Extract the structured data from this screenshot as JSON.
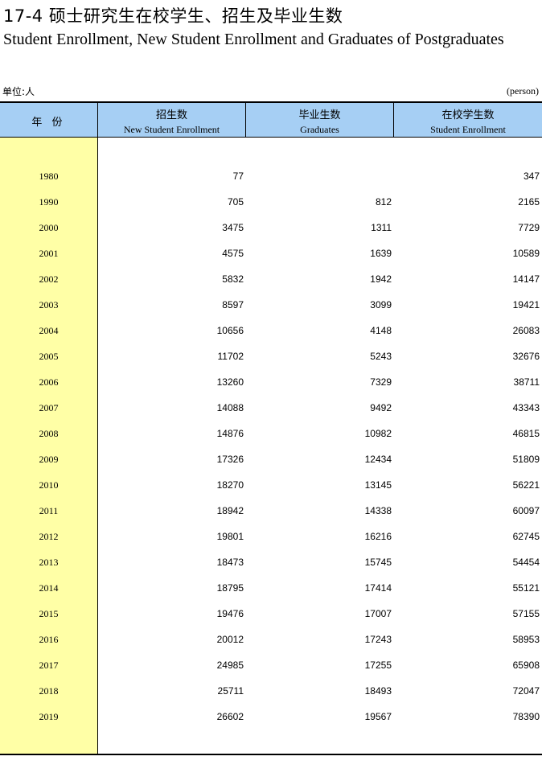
{
  "title_cn": "17-4  硕士研究生在校学生、招生及毕业生数",
  "title_en": "Student Enrollment, New Student Enrollment and Graduates of Postgraduates",
  "unit_cn": "单位:人",
  "unit_en": "(person)",
  "headers": {
    "year": "年 份",
    "new_cn": "招生数",
    "new_en": "New Student Enrollment",
    "grad_cn": "毕业生数",
    "grad_en": "Graduates",
    "enroll_cn": "在校学生数",
    "enroll_en": "Student Enrollment"
  },
  "rows": [
    {
      "year": "1980",
      "new": "77",
      "grad": "",
      "enroll": "347"
    },
    {
      "year": "1990",
      "new": "705",
      "grad": "812",
      "enroll": "2165"
    },
    {
      "year": "2000",
      "new": "3475",
      "grad": "1311",
      "enroll": "7729"
    },
    {
      "year": "2001",
      "new": "4575",
      "grad": "1639",
      "enroll": "10589"
    },
    {
      "year": "2002",
      "new": "5832",
      "grad": "1942",
      "enroll": "14147"
    },
    {
      "year": "2003",
      "new": "8597",
      "grad": "3099",
      "enroll": "19421"
    },
    {
      "year": "2004",
      "new": "10656",
      "grad": "4148",
      "enroll": "26083"
    },
    {
      "year": "2005",
      "new": "11702",
      "grad": "5243",
      "enroll": "32676"
    },
    {
      "year": "2006",
      "new": "13260",
      "grad": "7329",
      "enroll": "38711"
    },
    {
      "year": "2007",
      "new": "14088",
      "grad": "9492",
      "enroll": "43343"
    },
    {
      "year": "2008",
      "new": "14876",
      "grad": "10982",
      "enroll": "46815"
    },
    {
      "year": "2009",
      "new": "17326",
      "grad": "12434",
      "enroll": "51809"
    },
    {
      "year": "2010",
      "new": "18270",
      "grad": "13145",
      "enroll": "56221"
    },
    {
      "year": "2011",
      "new": "18942",
      "grad": "14338",
      "enroll": "60097"
    },
    {
      "year": "2012",
      "new": "19801",
      "grad": "16216",
      "enroll": "62745"
    },
    {
      "year": "2013",
      "new": "18473",
      "grad": "15745",
      "enroll": "54454"
    },
    {
      "year": "2014",
      "new": "18795",
      "grad": "17414",
      "enroll": "55121"
    },
    {
      "year": "2015",
      "new": "19476",
      "grad": "17007",
      "enroll": "57155"
    },
    {
      "year": "2016",
      "new": "20012",
      "grad": "17243",
      "enroll": "58953"
    },
    {
      "year": "2017",
      "new": "24985",
      "grad": "17255",
      "enroll": "65908"
    },
    {
      "year": "2018",
      "new": "25711",
      "grad": "18493",
      "enroll": "72047"
    },
    {
      "year": "2019",
      "new": "26602",
      "grad": "19567",
      "enroll": "78390"
    }
  ]
}
